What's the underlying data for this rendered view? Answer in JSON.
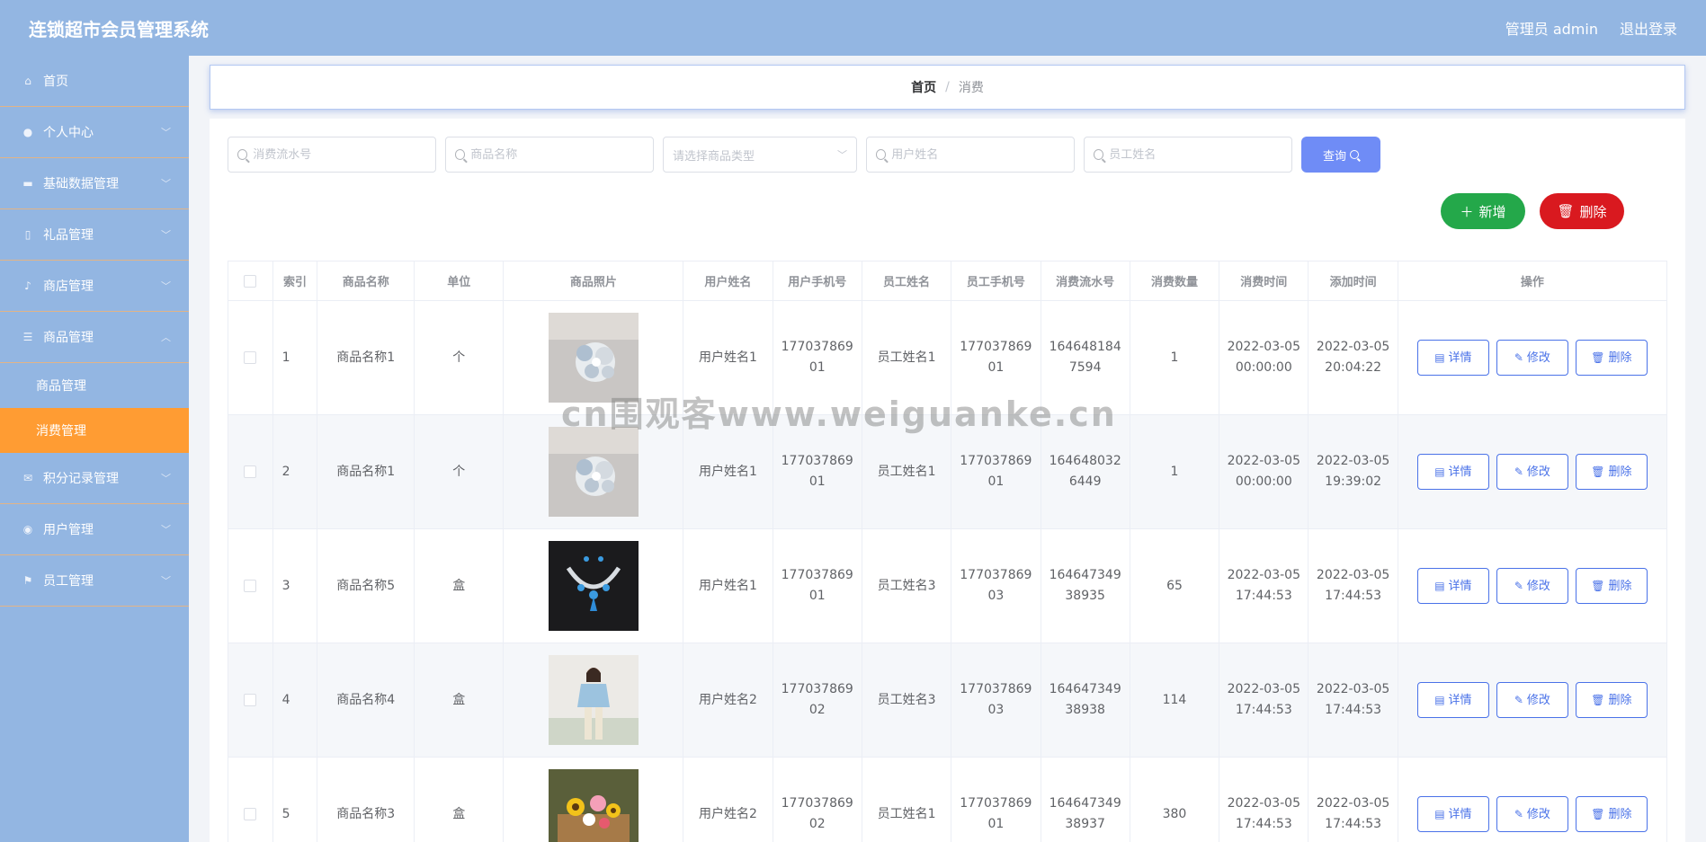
{
  "header": {
    "title": "连锁超市会员管理系统",
    "user_label": "管理员 admin",
    "logout": "退出登录"
  },
  "sidebar": {
    "items": [
      {
        "label": "首页",
        "icon": "home-icon"
      },
      {
        "label": "个人中心",
        "icon": "user-icon"
      },
      {
        "label": "基础数据管理",
        "icon": "data-icon"
      },
      {
        "label": "礼品管理",
        "icon": "gift-icon"
      },
      {
        "label": "商店管理",
        "icon": "mic-icon"
      },
      {
        "label": "商品管理",
        "icon": "menu-icon"
      }
    ],
    "subitems": [
      {
        "label": "商品管理",
        "active": false
      },
      {
        "label": "消费管理",
        "active": true
      }
    ],
    "items_after": [
      {
        "label": "积分记录管理",
        "icon": "mail-icon"
      },
      {
        "label": "用户管理",
        "icon": "user-circle-icon"
      },
      {
        "label": "员工管理",
        "icon": "flag-icon"
      }
    ]
  },
  "breadcrumb": {
    "home": "首页",
    "separator": "/",
    "current": "消费"
  },
  "search": {
    "serial_placeholder": "消费流水号",
    "product_placeholder": "商品名称",
    "type_placeholder": "请选择商品类型",
    "user_placeholder": "用户姓名",
    "staff_placeholder": "员工姓名",
    "query_label": "查询"
  },
  "actions": {
    "add_label": "新增",
    "delete_label": "删除"
  },
  "table": {
    "headers": [
      "索引",
      "商品名称",
      "单位",
      "商品照片",
      "用户姓名",
      "用户手机号",
      "员工姓名",
      "员工手机号",
      "消费流水号",
      "消费数量",
      "消费时间",
      "添加时间",
      "操作"
    ],
    "rows": [
      {
        "index": "1",
        "product": "商品名称1",
        "unit": "个",
        "photo": "jewelry-brooch",
        "user": "用户姓名1",
        "user_phone": "17703786901",
        "staff": "员工姓名1",
        "staff_phone": "17703786901",
        "serial": "1646481847594",
        "qty": "1",
        "time": "2022-03-05 00:00:00",
        "added": "2022-03-05 20:04:22"
      },
      {
        "index": "2",
        "product": "商品名称1",
        "unit": "个",
        "photo": "jewelry-brooch",
        "user": "用户姓名1",
        "user_phone": "17703786901",
        "staff": "员工姓名1",
        "staff_phone": "17703786901",
        "serial": "1646480326449",
        "qty": "1",
        "time": "2022-03-05 00:00:00",
        "added": "2022-03-05 19:39:02"
      },
      {
        "index": "3",
        "product": "商品名称5",
        "unit": "盒",
        "photo": "necklace",
        "user": "用户姓名1",
        "user_phone": "17703786901",
        "staff": "员工姓名3",
        "staff_phone": "17703786903",
        "serial": "16464734938935",
        "qty": "65",
        "time": "2022-03-05 17:44:53",
        "added": "2022-03-05 17:44:53"
      },
      {
        "index": "4",
        "product": "商品名称4",
        "unit": "盒",
        "photo": "fashion",
        "user": "用户姓名2",
        "user_phone": "17703786902",
        "staff": "员工姓名3",
        "staff_phone": "17703786903",
        "serial": "16464734938938",
        "qty": "114",
        "time": "2022-03-05 17:44:53",
        "added": "2022-03-05 17:44:53"
      },
      {
        "index": "5",
        "product": "商品名称3",
        "unit": "盒",
        "photo": "flowers",
        "user": "用户姓名2",
        "user_phone": "17703786902",
        "staff": "员工姓名1",
        "staff_phone": "17703786901",
        "serial": "16464734938937",
        "qty": "380",
        "time": "2022-03-05 17:44:53",
        "added": "2022-03-05 17:44:53"
      }
    ],
    "op_detail": "详情",
    "op_edit": "修改",
    "op_delete": "删除"
  },
  "watermark": "cn围观客www.weiguanke.cn",
  "colors": {
    "header_bg": "#93b6e2",
    "active_menu": "#ff9c33",
    "add_button": "#24a84a",
    "delete_button": "#d9191f",
    "query_button": "#6f8cf6",
    "op_button": "#4a72e8"
  }
}
